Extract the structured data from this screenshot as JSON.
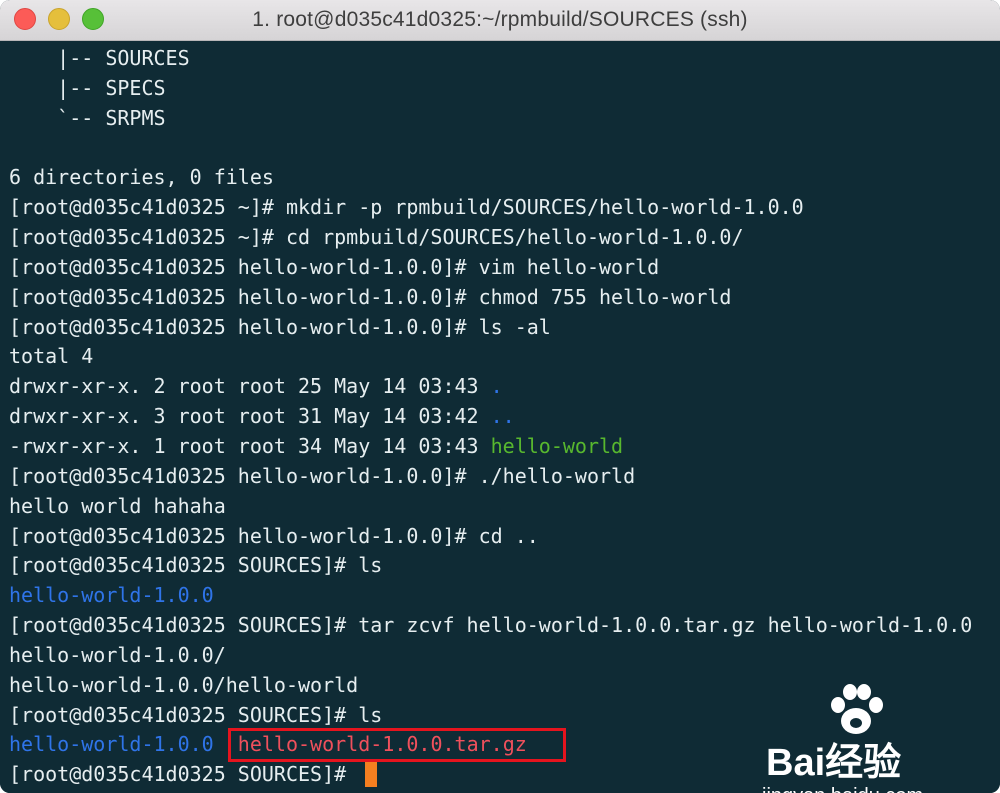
{
  "window": {
    "title": "1. root@d035c41d0325:~/rpmbuild/SOURCES (ssh)"
  },
  "terminal": {
    "lines": [
      [
        {
          "t": "    |-- SOURCES"
        }
      ],
      [
        {
          "t": "    |-- SPECS"
        }
      ],
      [
        {
          "t": "    `-- SRPMS"
        }
      ],
      [
        {
          "t": ""
        }
      ],
      [
        {
          "t": "6 directories, 0 files"
        }
      ],
      [
        {
          "t": "[root@d035c41d0325 ~]# mkdir -p rpmbuild/SOURCES/hello-world-1.0.0"
        }
      ],
      [
        {
          "t": "[root@d035c41d0325 ~]# cd rpmbuild/SOURCES/hello-world-1.0.0/"
        }
      ],
      [
        {
          "t": "[root@d035c41d0325 hello-world-1.0.0]# vim hello-world"
        }
      ],
      [
        {
          "t": "[root@d035c41d0325 hello-world-1.0.0]# chmod 755 hello-world"
        }
      ],
      [
        {
          "t": "[root@d035c41d0325 hello-world-1.0.0]# ls -al"
        }
      ],
      [
        {
          "t": "total 4"
        }
      ],
      [
        {
          "t": "drwxr-xr-x. 2 root root 25 May 14 03:43 "
        },
        {
          "t": ".",
          "c": "blue"
        }
      ],
      [
        {
          "t": "drwxr-xr-x. 3 root root 31 May 14 03:42 "
        },
        {
          "t": "..",
          "c": "blue"
        }
      ],
      [
        {
          "t": "-rwxr-xr-x. 1 root root 34 May 14 03:43 "
        },
        {
          "t": "hello-world",
          "c": "green"
        }
      ],
      [
        {
          "t": "[root@d035c41d0325 hello-world-1.0.0]# ./hello-world"
        }
      ],
      [
        {
          "t": "hello world hahaha"
        }
      ],
      [
        {
          "t": "[root@d035c41d0325 hello-world-1.0.0]# cd .."
        }
      ],
      [
        {
          "t": "[root@d035c41d0325 SOURCES]# ls"
        }
      ],
      [
        {
          "t": "hello-world-1.0.0",
          "c": "blue"
        }
      ],
      [
        {
          "t": "[root@d035c41d0325 SOURCES]# tar zcvf hello-world-1.0.0.tar.gz hello-world-1.0.0"
        }
      ],
      [
        {
          "t": "hello-world-1.0.0/"
        }
      ],
      [
        {
          "t": "hello-world-1.0.0/hello-world"
        }
      ],
      [
        {
          "t": "[root@d035c41d0325 SOURCES]# ls"
        }
      ],
      [
        {
          "t": "hello-world-1.0.0",
          "c": "blue"
        },
        {
          "t": "  "
        },
        {
          "t": "hello-world-1.0.0.tar.gz",
          "c": "red"
        }
      ],
      [
        {
          "t": "[root@d035c41d0325 SOURCES]# "
        }
      ]
    ]
  },
  "watermark": {
    "brand": "Bai经验",
    "url": "jingyan.baidu.com",
    "icon": "paw-icon"
  },
  "colors": {
    "background": "#0f2b35",
    "text": "#e6eef0",
    "directory": "#2f74e8",
    "executable": "#58b82e",
    "archive": "#f0505c",
    "highlight_box": "#e5141e",
    "cursor": "#f57f20"
  }
}
